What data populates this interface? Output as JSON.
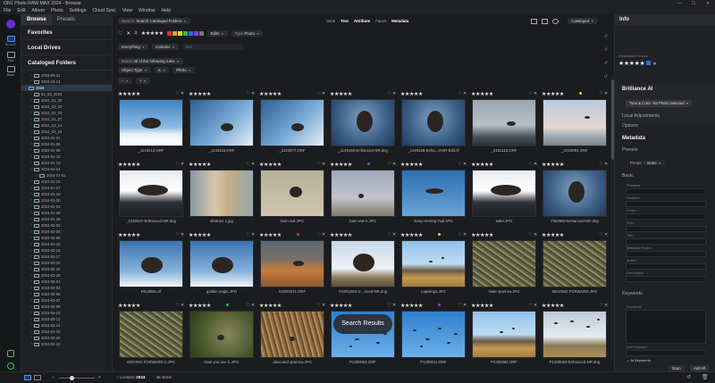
{
  "window": {
    "title": "ON1 Photo RAW MAX 2024 - Browse",
    "controls": [
      "—",
      "☐",
      "✕"
    ]
  },
  "menu": [
    "File",
    "Edit",
    "Album",
    "Photo",
    "Settings",
    "Cloud Sync",
    "View",
    "Window",
    "Help"
  ],
  "rail": [
    {
      "label": "Browse",
      "active": true
    },
    {
      "label": "Edit"
    },
    {
      "label": "Book"
    }
  ],
  "left": {
    "tabs": [
      "Browse",
      "Presets"
    ],
    "sections": [
      "Favorites",
      "Local Drives",
      "Cataloged Folders"
    ],
    "tree": [
      {
        "label": "2023-09-21",
        "depth": 1,
        "arrow": "›"
      },
      {
        "label": "2023-10-14",
        "depth": 1,
        "arrow": "›"
      },
      {
        "label": "2024",
        "depth": 0,
        "arrow": "⌄",
        "sel": true
      },
      {
        "label": "01_02_2024",
        "depth": 1,
        "arrow": "›"
      },
      {
        "label": "2024_01_30",
        "depth": 1,
        "arrow": "›"
      },
      {
        "label": "2024_02_02",
        "depth": 1,
        "arrow": "›"
      },
      {
        "label": "2024_02_03",
        "depth": 1,
        "arrow": "›"
      },
      {
        "label": "2024_02_07",
        "depth": 1,
        "arrow": "›"
      },
      {
        "label": "2024_02_13",
        "depth": 1,
        "arrow": "›"
      },
      {
        "label": "2024_02_16",
        "depth": 1,
        "arrow": "›"
      },
      {
        "label": "2024-01-01",
        "depth": 1,
        "arrow": "›"
      },
      {
        "label": "2024-01-05",
        "depth": 1,
        "arrow": "›"
      },
      {
        "label": "2024-01-06",
        "depth": 1,
        "arrow": "›"
      },
      {
        "label": "2024-01-12",
        "depth": 1,
        "arrow": "›"
      },
      {
        "label": "2024-01-13",
        "depth": 1,
        "arrow": "›"
      },
      {
        "label": "2024-01-14",
        "depth": 1,
        "arrow": "⌄"
      },
      {
        "label": "2024-01-02",
        "depth": 2,
        "arrow": "›"
      },
      {
        "label": "2024-01-15",
        "depth": 1,
        "arrow": "›"
      },
      {
        "label": "2024-01-17",
        "depth": 1,
        "arrow": "›"
      },
      {
        "label": "2024-01-18",
        "depth": 1,
        "arrow": "›"
      },
      {
        "label": "2024-01-20",
        "depth": 1,
        "arrow": "›"
      },
      {
        "label": "2024-01-23",
        "depth": 1,
        "arrow": "›"
      },
      {
        "label": "2024-01-28",
        "depth": 1,
        "arrow": "›"
      },
      {
        "label": "2024-01-30",
        "depth": 1,
        "arrow": "›"
      },
      {
        "label": "2024-02-02",
        "depth": 1,
        "arrow": "›"
      },
      {
        "label": "2024-02-06",
        "depth": 1,
        "arrow": "›"
      },
      {
        "label": "2024-02-08",
        "depth": 1,
        "arrow": "›"
      },
      {
        "label": "2024-02-10",
        "depth": 1,
        "arrow": "›"
      },
      {
        "label": "2024-02-16",
        "depth": 1,
        "arrow": "›"
      },
      {
        "label": "2024-02-17",
        "depth": 1,
        "arrow": "›"
      },
      {
        "label": "2024-02-20",
        "depth": 1,
        "arrow": "›"
      },
      {
        "label": "2024-02-22",
        "depth": 1,
        "arrow": "›"
      },
      {
        "label": "2024-02-28",
        "depth": 1,
        "arrow": "›"
      },
      {
        "label": "2024-03-01",
        "depth": 1,
        "arrow": "›"
      },
      {
        "label": "2024-03-02",
        "depth": 1,
        "arrow": "›"
      },
      {
        "label": "2024-03-05",
        "depth": 1,
        "arrow": "›"
      },
      {
        "label": "2024-03-07",
        "depth": 1,
        "arrow": "›"
      },
      {
        "label": "2024-03-09",
        "depth": 1,
        "arrow": "›"
      },
      {
        "label": "2024-03-10",
        "depth": 1,
        "arrow": "›"
      },
      {
        "label": "2024-03-12",
        "depth": 1,
        "arrow": "›"
      },
      {
        "label": "2024-03-14",
        "depth": 1,
        "arrow": "›"
      },
      {
        "label": "2024-03-18",
        "depth": 1,
        "arrow": "›"
      },
      {
        "label": "2024-03-20",
        "depth": 1,
        "arrow": "›"
      },
      {
        "label": "2024-03-22",
        "depth": 1,
        "arrow": "›"
      }
    ]
  },
  "toolbar": {
    "search_label": "Search",
    "search_value": "Search Cataloged Folders",
    "view_modes": [
      "None",
      "Text",
      "Attribute",
      "Faces",
      "Metadata"
    ],
    "view_active": "Metadata",
    "catalog_label": "Cataloged",
    "edits_label": "Edits",
    "type_label": "Type",
    "type_value": "Photo",
    "filter_everything": "Everything",
    "filter_contains": "contains",
    "filter_text": "bird",
    "match_label": "Match",
    "match_value": "All of the following rules",
    "rule_field": "Object Type",
    "rule_op": "is",
    "rule_value": "Photo",
    "stars_full": "★★★★★",
    "stars_ge": "≥",
    "add_rule": "+",
    "remove_rule": "−"
  },
  "grid": [
    {
      "name": "_1143212.ORF",
      "dot": "",
      "scene": "snowbird"
    },
    {
      "name": "_1143116.ORF",
      "dot": "",
      "scene": "snowtree"
    },
    {
      "name": "_1143877.ORF",
      "dot": "",
      "scene": "snowtree"
    },
    {
      "name": "_1149159-Enhanced-NR.dng",
      "dot": "",
      "scene": "owldark"
    },
    {
      "name": "_1149159-Enha...d-NR-Edit.tif",
      "dot": "",
      "scene": "owldark"
    },
    {
      "name": "_2181110.ORF",
      "dot": "",
      "scene": "skygray"
    },
    {
      "name": "_2220094.ORF",
      "dot": "#d9e21a",
      "scene": "dawn"
    },
    {
      "name": "_2240637-Enhanced-NR.dng",
      "dot": "",
      "scene": "waterbird"
    },
    {
      "name": "abstract 1.jpg",
      "dot": "",
      "scene": "abstract"
    },
    {
      "name": "barn owl.JPG",
      "dot": "",
      "scene": "tan"
    },
    {
      "name": "barn owl-2.JPG",
      "dot": "#2a6fe0",
      "scene": "branches"
    },
    {
      "name": "Easy Herring Gull.JPG",
      "dot": "",
      "scene": "gull"
    },
    {
      "name": "eider.JPG",
      "dot": "",
      "scene": "waterbird"
    },
    {
      "name": "File2552-Enhanced-NR.dng",
      "dot": "",
      "scene": "owldark"
    },
    {
      "name": "File2950.orf",
      "dot": "",
      "scene": "hawkblue"
    },
    {
      "name": "golden eagle.JPG",
      "dot": "",
      "scene": "hawkblue"
    },
    {
      "name": "IVOR0571.ORF",
      "dot": "#e03b2c",
      "scene": "rocks"
    },
    {
      "name": "IVOR1083-3-...nced-NR.dng",
      "dot": "",
      "scene": "raven"
    },
    {
      "name": "Lapwings.JPG",
      "dot": "#d9e21a",
      "scene": "pier"
    },
    {
      "name": "male sparrow.JPG",
      "dot": "",
      "scene": "twigs"
    },
    {
      "name": "MOVING FORWARD.JPG",
      "dot": "",
      "scene": "twigs"
    },
    {
      "name": "MOVING FORWARD 2.JPG",
      "dot": "",
      "scene": "twigs"
    },
    {
      "name": "Now you see it..JPG",
      "dot": "#2fbf3a",
      "scene": "hedge"
    },
    {
      "name": "obscured sparrow.JPG",
      "dot": "",
      "scene": "reeds"
    },
    {
      "name": "P1300004.ORF",
      "dot": "",
      "scene": "flock"
    },
    {
      "name": "P1300011.ORF",
      "dot": "#8a3cd8",
      "scene": "flock"
    },
    {
      "name": "P1300062.ORF",
      "dot": "",
      "scene": "pier"
    },
    {
      "name": "P1300063-Enhanced-NR.dng",
      "dot": "",
      "scene": "pierflock"
    }
  ],
  "overlay": "Search Results",
  "right": {
    "header": "Info",
    "embedded_preview": "Embedded Preview",
    "brilliance": "Brilliance AI",
    "tone_color": "Tone & Color",
    "no_photo": "No Photo Selected",
    "local_adjustments": "Local Adjustments",
    "options": "Options",
    "metadata": "Metadata",
    "presets": "Presets",
    "preset_label": "Preset",
    "preset_value": "None",
    "basic": "Basic",
    "fields": [
      {
        "label": "Filename",
        "value": ""
      },
      {
        "label": "Headline",
        "value": ""
      },
      {
        "label": "Folder",
        "value": ""
      },
      {
        "label": "2024",
        "value": ""
      },
      {
        "label": "Title",
        "value": ""
      },
      {
        "label": "Metadata Status",
        "value": ""
      },
      {
        "label": "Author",
        "value": ""
      },
      {
        "label": "Description",
        "value": ""
      }
    ],
    "keywords": "Keywords",
    "keywords_label": "Keywords",
    "add_keyword": "Add Keyword",
    "ai_keywords": "AI Keywords",
    "scan": "Scan",
    "add_all": "Add All"
  },
  "bottom": {
    "location_label": "Location",
    "location_value": "2024",
    "items": "35 items",
    "zoom": "◉"
  }
}
